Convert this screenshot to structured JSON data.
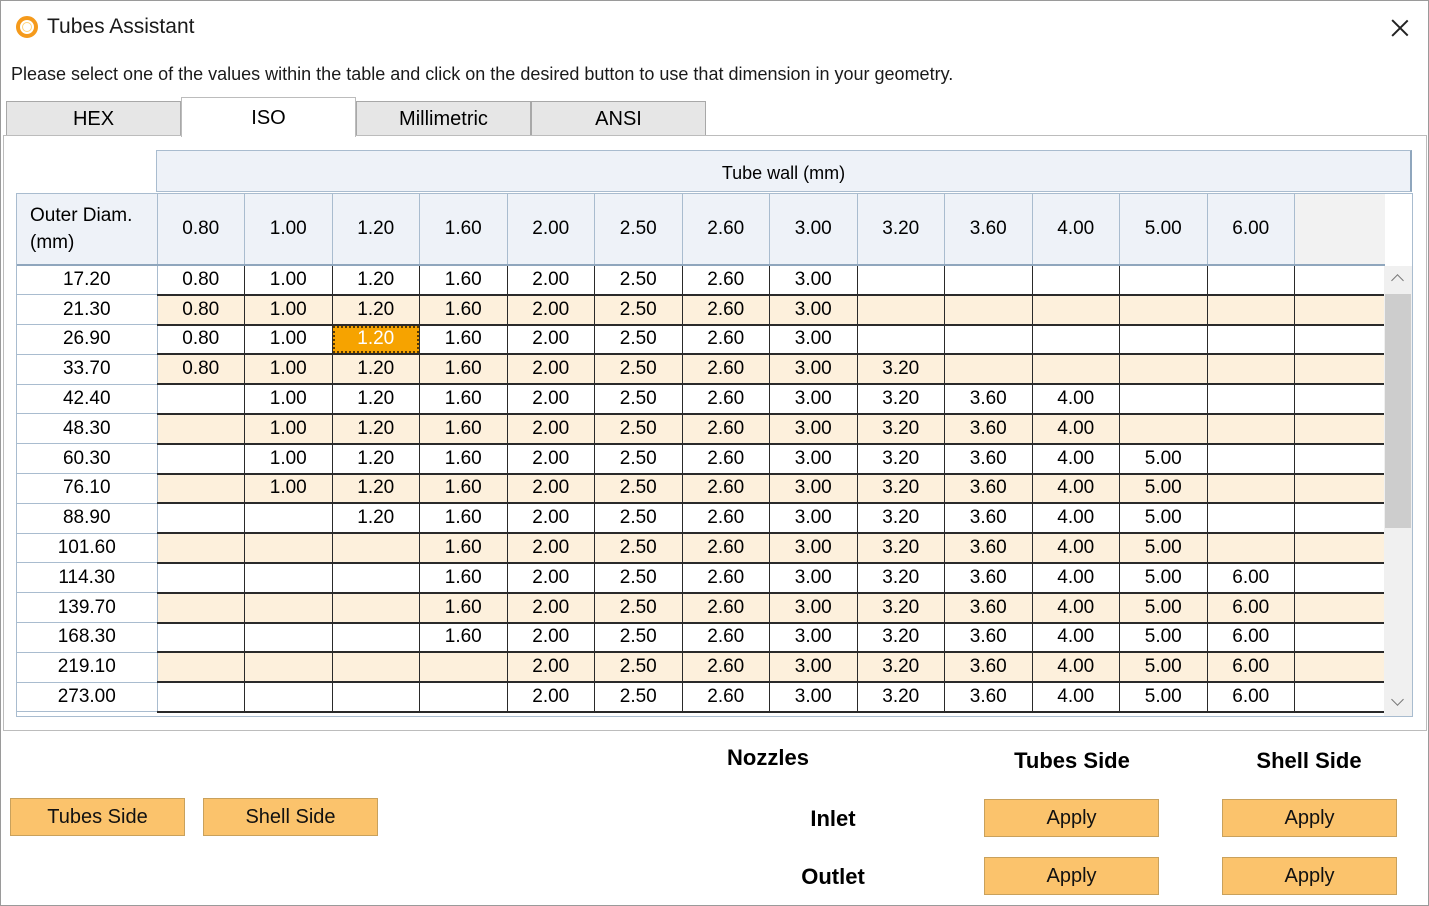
{
  "window": {
    "title": "Tubes Assistant",
    "icon": "app-ring-icon"
  },
  "instructions": "Please select one of the values within the table and click on the desired button to use that dimension in your geometry.",
  "tabs": [
    {
      "label": "HEX",
      "active": false
    },
    {
      "label": "ISO",
      "active": true
    },
    {
      "label": "Millimetric",
      "active": false
    },
    {
      "label": "ANSI",
      "active": false
    }
  ],
  "table": {
    "wall_header": "Tube wall (mm)",
    "diam_header": [
      "Outer Diam.",
      "(mm)"
    ],
    "columns": [
      "0.80",
      "1.00",
      "1.20",
      "1.60",
      "2.00",
      "2.50",
      "2.60",
      "3.00",
      "3.20",
      "3.60",
      "4.00",
      "5.00",
      "6.00"
    ],
    "selected": {
      "row": 2,
      "col": 2
    },
    "rows": [
      {
        "od": "17.20",
        "cells": [
          "0.80",
          "1.00",
          "1.20",
          "1.60",
          "2.00",
          "2.50",
          "2.60",
          "3.00",
          "",
          "",
          "",
          "",
          ""
        ]
      },
      {
        "od": "21.30",
        "cells": [
          "0.80",
          "1.00",
          "1.20",
          "1.60",
          "2.00",
          "2.50",
          "2.60",
          "3.00",
          "",
          "",
          "",
          "",
          ""
        ]
      },
      {
        "od": "26.90",
        "cells": [
          "0.80",
          "1.00",
          "1.20",
          "1.60",
          "2.00",
          "2.50",
          "2.60",
          "3.00",
          "",
          "",
          "",
          "",
          ""
        ]
      },
      {
        "od": "33.70",
        "cells": [
          "0.80",
          "1.00",
          "1.20",
          "1.60",
          "2.00",
          "2.50",
          "2.60",
          "3.00",
          "3.20",
          "",
          "",
          "",
          ""
        ]
      },
      {
        "od": "42.40",
        "cells": [
          "",
          "1.00",
          "1.20",
          "1.60",
          "2.00",
          "2.50",
          "2.60",
          "3.00",
          "3.20",
          "3.60",
          "4.00",
          "",
          ""
        ]
      },
      {
        "od": "48.30",
        "cells": [
          "",
          "1.00",
          "1.20",
          "1.60",
          "2.00",
          "2.50",
          "2.60",
          "3.00",
          "3.20",
          "3.60",
          "4.00",
          "",
          ""
        ]
      },
      {
        "od": "60.30",
        "cells": [
          "",
          "1.00",
          "1.20",
          "1.60",
          "2.00",
          "2.50",
          "2.60",
          "3.00",
          "3.20",
          "3.60",
          "4.00",
          "5.00",
          ""
        ]
      },
      {
        "od": "76.10",
        "cells": [
          "",
          "1.00",
          "1.20",
          "1.60",
          "2.00",
          "2.50",
          "2.60",
          "3.00",
          "3.20",
          "3.60",
          "4.00",
          "5.00",
          ""
        ]
      },
      {
        "od": "88.90",
        "cells": [
          "",
          "",
          "1.20",
          "1.60",
          "2.00",
          "2.50",
          "2.60",
          "3.00",
          "3.20",
          "3.60",
          "4.00",
          "5.00",
          ""
        ]
      },
      {
        "od": "101.60",
        "cells": [
          "",
          "",
          "",
          "1.60",
          "2.00",
          "2.50",
          "2.60",
          "3.00",
          "3.20",
          "3.60",
          "4.00",
          "5.00",
          ""
        ]
      },
      {
        "od": "114.30",
        "cells": [
          "",
          "",
          "",
          "1.60",
          "2.00",
          "2.50",
          "2.60",
          "3.00",
          "3.20",
          "3.60",
          "4.00",
          "5.00",
          "6.00"
        ]
      },
      {
        "od": "139.70",
        "cells": [
          "",
          "",
          "",
          "1.60",
          "2.00",
          "2.50",
          "2.60",
          "3.00",
          "3.20",
          "3.60",
          "4.00",
          "5.00",
          "6.00"
        ]
      },
      {
        "od": "168.30",
        "cells": [
          "",
          "",
          "",
          "1.60",
          "2.00",
          "2.50",
          "2.60",
          "3.00",
          "3.20",
          "3.60",
          "4.00",
          "5.00",
          "6.00"
        ]
      },
      {
        "od": "219.10",
        "cells": [
          "",
          "",
          "",
          "",
          "2.00",
          "2.50",
          "2.60",
          "3.00",
          "3.20",
          "3.60",
          "4.00",
          "5.00",
          "6.00"
        ]
      },
      {
        "od": "273.00",
        "cells": [
          "",
          "",
          "",
          "",
          "2.00",
          "2.50",
          "2.60",
          "3.00",
          "3.20",
          "3.60",
          "4.00",
          "5.00",
          "6.00"
        ]
      }
    ],
    "scroll_position": 0.0
  },
  "actions": {
    "nozzles_label": "Nozzles",
    "tubes_side_label": "Tubes Side",
    "shell_side_label": "Shell Side",
    "inlet_label": "Inlet",
    "outlet_label": "Outlet",
    "tubes_side_button": "Tubes Side",
    "shell_side_button": "Shell Side",
    "apply_label": "Apply"
  },
  "colors": {
    "accent": "#fbc36c",
    "selected_cell": "#f6a300",
    "alt_row": "#fdf0dc",
    "header_bg": "#eef2f8"
  }
}
